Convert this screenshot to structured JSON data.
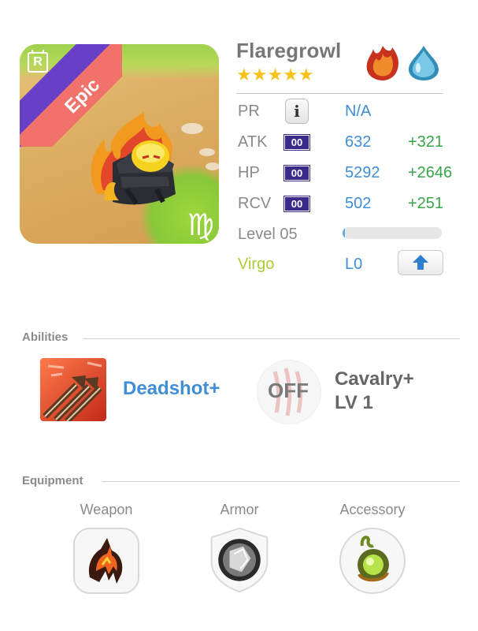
{
  "portrait": {
    "rarity": "Epic",
    "rarity_badge": "R",
    "zodiac_symbol": "♍"
  },
  "creature": {
    "name": "Flaregrowl",
    "stars": "★★★★★",
    "elements": [
      "fire-element-icon",
      "water-element-icon"
    ]
  },
  "stats": {
    "pr": {
      "label": "PR",
      "value": "N/A",
      "info": "i"
    },
    "atk": {
      "label": "ATK",
      "badge": "00",
      "value": "632",
      "bonus": "+321"
    },
    "hp": {
      "label": "HP",
      "badge": "00",
      "value": "5292",
      "bonus": "+2646"
    },
    "rcv": {
      "label": "RCV",
      "badge": "00",
      "value": "502",
      "bonus": "+251"
    },
    "level": {
      "label": "Level 05",
      "progress": 0.01
    },
    "zodiac": {
      "label": "Virgo",
      "value": "L0"
    }
  },
  "abilities": {
    "title": "Abilities",
    "items": [
      {
        "name": "Deadshot+",
        "icon": "deadshot-arrows-icon"
      },
      {
        "name_line1": "Cavalry+",
        "name_line2": "LV 1",
        "status": "OFF",
        "icon": "claw-scratch-icon"
      }
    ]
  },
  "equipment": {
    "title": "Equipment",
    "slots": [
      {
        "label": "Weapon",
        "icon": "lava-claw-icon"
      },
      {
        "label": "Armor",
        "icon": "crystal-shield-icon"
      },
      {
        "label": "Accessory",
        "icon": "green-gem-icon"
      }
    ]
  },
  "colors": {
    "accent_blue": "#3f8ed6",
    "bonus_green": "#39a44a",
    "virgo_green": "#a9cd33",
    "star_gold": "#f4c21b",
    "rarity_red": "#f0726b",
    "rarity_purple": "#6a3fc8"
  }
}
